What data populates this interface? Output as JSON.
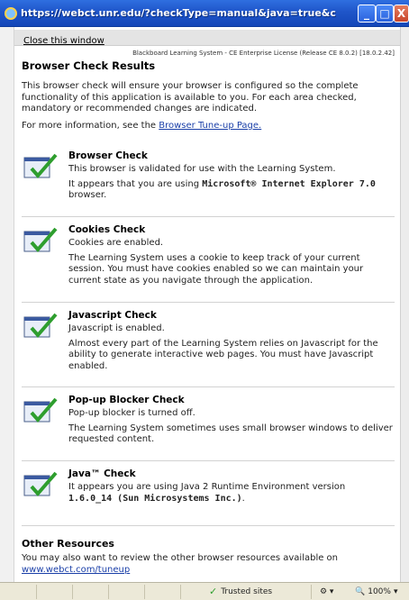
{
  "window": {
    "title": "https://webct.unr.edu/?checkType=manual&java=true&cookies=true&p...",
    "minimize": "_",
    "maximize": "□",
    "close": "X"
  },
  "linkbar": {
    "close_label": "Close this window"
  },
  "header": {
    "license": "Blackboard Learning System - CE Enterprise License (Release CE 8.0.2) [18.0.2.42]",
    "title": "Browser Check Results",
    "intro": "This browser check will ensure your browser is configured so the complete functionality of this application is available to you. For each area checked, mandatory or recommended changes are indicated.",
    "more_prefix": "For more information, see the ",
    "more_link": "Browser Tune-up Page."
  },
  "checks": [
    {
      "title": "Browser Check",
      "status": "This browser is validated for use with the Learning System.",
      "detail_prefix": "It appears that you are using ",
      "detail_bold": "Microsoft® Internet Explorer 7.0",
      "detail_suffix": " browser."
    },
    {
      "title": "Cookies Check",
      "status": "Cookies are enabled.",
      "detail": "The Learning System uses a cookie to keep track of your current session. You must have cookies enabled so we can maintain your current state as you navigate through the application."
    },
    {
      "title": "Javascript Check",
      "status": "Javascript is enabled.",
      "detail": "Almost every part of the Learning System relies on Javascript for the ability to generate interactive web pages. You must have Javascript enabled."
    },
    {
      "title": "Pop-up Blocker Check",
      "status": "Pop-up blocker is turned off.",
      "detail": "The Learning System sometimes uses small browser windows to deliver requested content."
    },
    {
      "title": "Java™ Check",
      "status": "It appears you are using Java 2 Runtime Environment version",
      "status_bold": "1.6.0_14 (Sun Microsystems Inc.)",
      "status_suffix": "."
    }
  ],
  "other": {
    "title": "Other Resources",
    "text": "You may also want to review the other browser resources available on",
    "link": "www.webct.com/tuneup"
  },
  "statusbar": {
    "zone": "Trusted sites",
    "zoom": "100%"
  },
  "colors": {
    "titlebar": "#1f55c9",
    "link": "#1a3fa8",
    "check": "#2e9e2e"
  }
}
